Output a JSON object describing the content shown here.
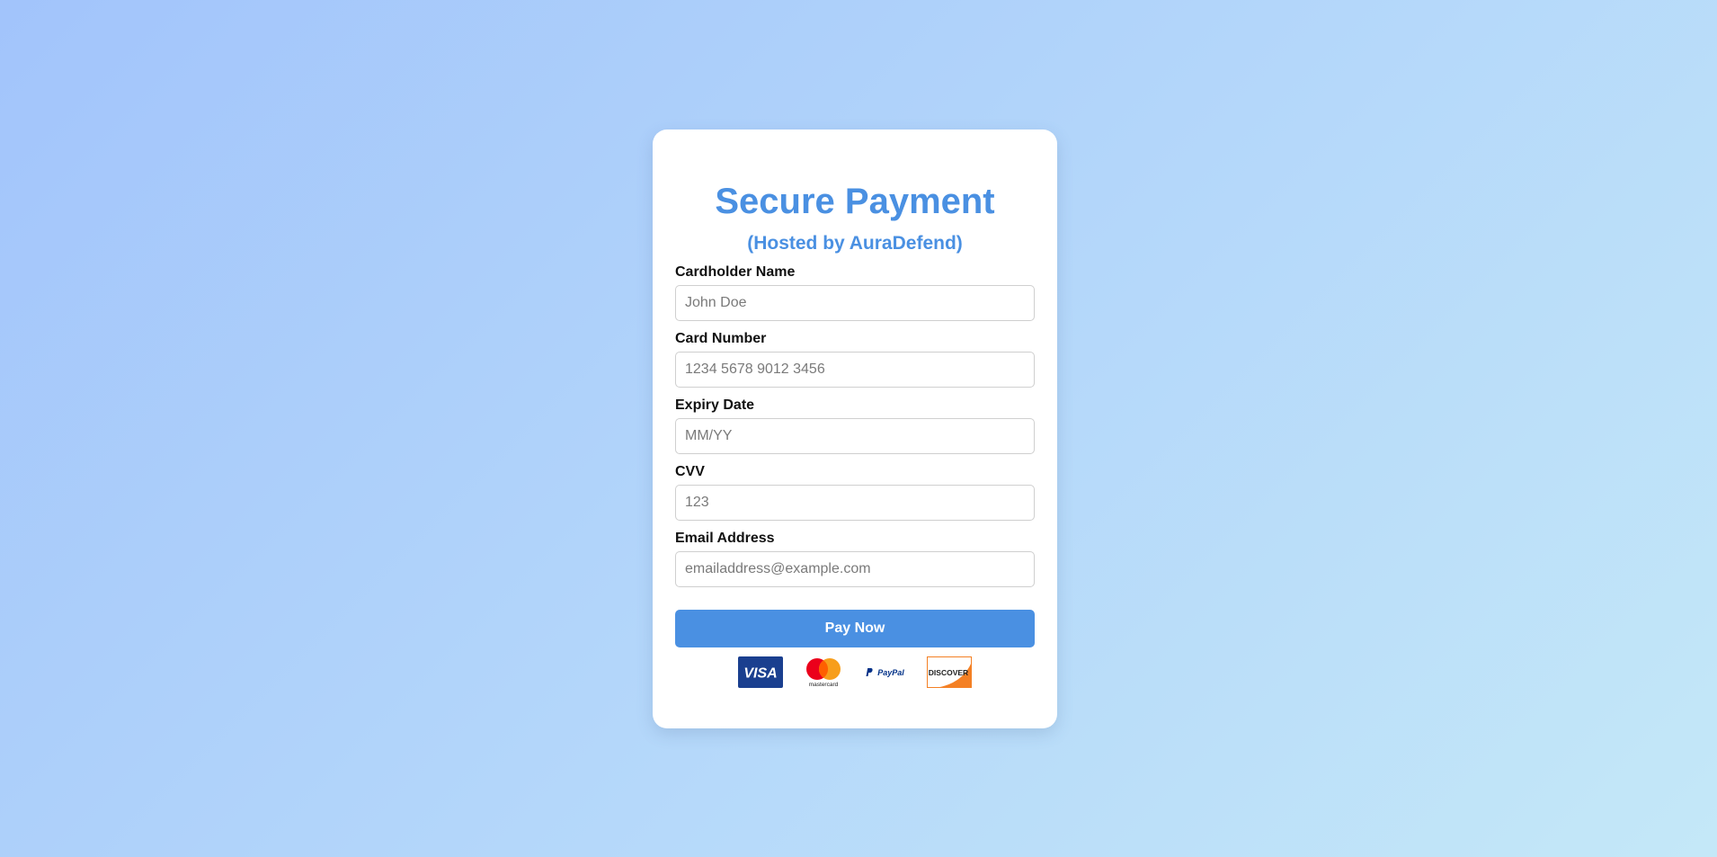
{
  "header": {
    "title": "Secure Payment",
    "subtitle": "(Hosted by AuraDefend)"
  },
  "form": {
    "fields": [
      {
        "label": "Cardholder Name",
        "placeholder": "John Doe",
        "value": ""
      },
      {
        "label": "Card Number",
        "placeholder": "1234 5678 9012 3456",
        "value": ""
      },
      {
        "label": "Expiry Date",
        "placeholder": "MM/YY",
        "value": ""
      },
      {
        "label": "CVV",
        "placeholder": "123",
        "value": ""
      },
      {
        "label": "Email Address",
        "placeholder": "emailaddress@example.com",
        "value": ""
      }
    ],
    "submit_label": "Pay Now"
  },
  "payment_logos": [
    {
      "name": "visa-logo",
      "text": "VISA"
    },
    {
      "name": "mastercard-logo",
      "text": "mastercard"
    },
    {
      "name": "paypal-logo",
      "text": "PayPal"
    },
    {
      "name": "discover-logo",
      "text": "DISCOVER"
    }
  ],
  "colors": {
    "accent": "#4a90e2",
    "visa_blue": "#1a3f8f",
    "mastercard_red": "#eb001b",
    "mastercard_orange": "#f79e1b",
    "discover_orange": "#f48024"
  }
}
